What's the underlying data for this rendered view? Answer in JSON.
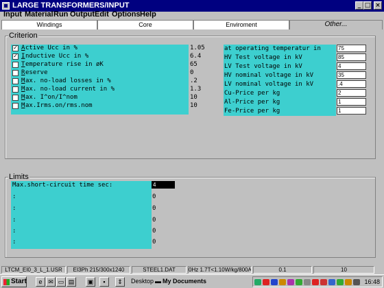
{
  "window": {
    "title": "LARGE TRANSFORMERS/INPUT",
    "min": "_",
    "max": "□",
    "close": "×"
  },
  "menu": [
    "Input",
    "Material",
    "Run",
    "Output",
    "Edit",
    "Options",
    "Help"
  ],
  "tabs": [
    "Windings",
    "Core",
    "Enviroment",
    "Other..."
  ],
  "criterion": {
    "label": "Criterion",
    "rows": [
      {
        "checked": "✓",
        "prefix": "A",
        "label": "ctive Ucc in %",
        "value": "1.05"
      },
      {
        "checked": "✓",
        "prefix": "I",
        "label": "nductive Ucc in %",
        "value": "6.4"
      },
      {
        "checked": "",
        "prefix": "T",
        "label": "emperature rise in øK",
        "value": "65"
      },
      {
        "checked": "",
        "prefix": "R",
        "label": "eserve",
        "value": "0"
      },
      {
        "checked": "",
        "prefix": "M",
        "label": "ax. no-load losses in %",
        "value": ".2"
      },
      {
        "checked": "",
        "prefix": "M",
        "label": "ax. no-load current in %",
        "value": "1.3"
      },
      {
        "checked": "",
        "prefix": "M",
        "label": "ax. I^on/I^nom",
        "value": "10"
      },
      {
        "checked": "",
        "prefix": "M",
        "label": "ax.Irms.on/rms.nom",
        "value": "10"
      }
    ],
    "params": [
      {
        "label": "at operating temperatur in",
        "value": "75"
      },
      {
        "label": "HV Test voltage in kV",
        "value": "85"
      },
      {
        "label": "LV Test voltage in kV",
        "value": "4"
      },
      {
        "label": "HV nominal voltage in kV",
        "value": "35"
      },
      {
        "label": "LV nominal voltage in kV",
        "value": ".4"
      },
      {
        "label": "Cu-Price per kg",
        "value": "2"
      },
      {
        "label": "Al-Price per kg",
        "value": "1"
      },
      {
        "label": "Fe-Price per kg",
        "value": "1"
      }
    ]
  },
  "limits": {
    "label": "Limits",
    "rows": [
      {
        "label": "Max.short-circuit time  sec:",
        "value": "4"
      },
      {
        "label": ":",
        "value": "0"
      },
      {
        "label": ":",
        "value": "0"
      },
      {
        "label": ":",
        "value": "0"
      },
      {
        "label": ":",
        "value": "0"
      },
      {
        "label": ":",
        "value": "0"
      }
    ]
  },
  "status": [
    "LTCM_EI0_3_L_1.USR",
    "EI3Ph 215/300x1240",
    "STEEL1.DAT",
    "0Hz 1.7T<1.10W/kg/800A",
    "0.1",
    "10"
  ],
  "taskbar": {
    "start": "Start",
    "desktop": "Desktop",
    "mydocs": "My Documents",
    "clock": "16:48"
  }
}
